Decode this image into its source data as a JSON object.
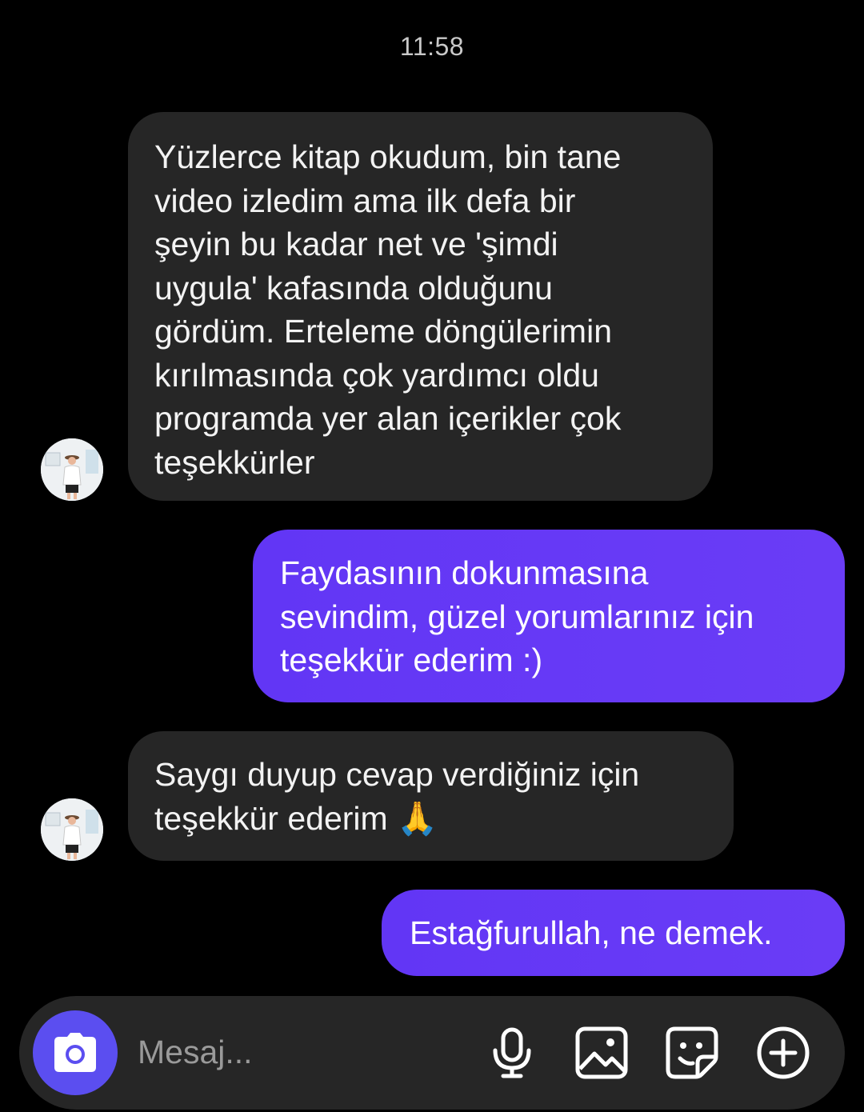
{
  "conversation": {
    "timestamp": "11:58",
    "messages": [
      {
        "direction": "incoming",
        "text": "Yüzlerce kitap okudum, bin tane\nvideo izledim ama ilk defa bir\nşeyin bu kadar net ve 'şimdi\nuygula' kafasında olduğunu\ngördüm. Erteleme döngülerimin\nkırılmasında çok yardımcı oldu\nprogramda yer alan içerikler çok\nteşekkürler"
      },
      {
        "direction": "outgoing",
        "text": "Faydasının dokunmasına\nsevindim, güzel yorumlarınız için\nteşekkür ederim :)"
      },
      {
        "direction": "incoming",
        "text": "Saygı duyup cevap verdiğiniz için\nteşekkür ederim 🙏"
      },
      {
        "direction": "outgoing",
        "text": "Estağfurullah, ne demek."
      }
    ]
  },
  "composer": {
    "placeholder": "Mesaj...",
    "value": "",
    "icons": [
      "camera-icon",
      "microphone-icon",
      "gallery-icon",
      "sticker-icon",
      "plus-icon"
    ]
  },
  "colors": {
    "background": "#000000",
    "incoming_bubble": "#262626",
    "outgoing_bubble": "#6236f5",
    "camera_button": "#5b4ef0"
  }
}
